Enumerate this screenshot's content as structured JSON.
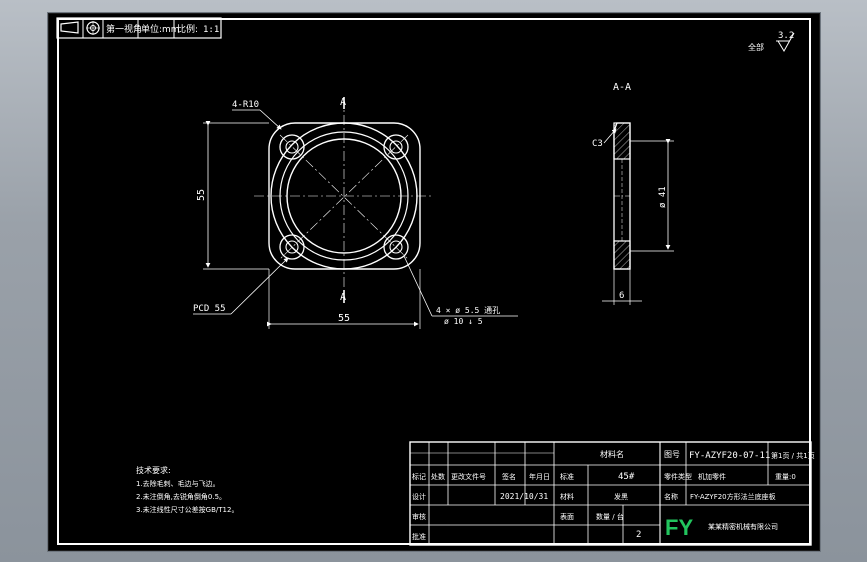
{
  "corner_tag": {
    "label1": "第一视角",
    "label2": "单位:mm",
    "label3": "比例:",
    "scale": "1:1"
  },
  "roughness": {
    "prefix": "全部",
    "value": "3.2"
  },
  "section": {
    "label": "A-A",
    "cut_top": "A",
    "cut_bottom": "A"
  },
  "front_view": {
    "corner_radius": "4-R10",
    "height_dim": "55",
    "width_dim": "55",
    "pcd": "PCD 55",
    "holes_note_1": "4 × ø 5.5 通孔",
    "holes_note_2": "ø 10 ↓ 5"
  },
  "side_view": {
    "chamfer": "C3",
    "dia_dim": "ø 41",
    "thickness_dim": "6"
  },
  "tech_req": {
    "title": "技术要求:",
    "lines": [
      "1.去除毛刺、毛边与飞边。",
      "2.未注倒角,去锐角倒角0.5。",
      "3.未注线性尺寸公差按GB/T12。"
    ]
  },
  "title_block": {
    "material_hdr": "材料名",
    "drawing_no": "FY-AZYF20-07-11",
    "sheet": "第1页 / 共1页",
    "col_marks": [
      "标记",
      "处数",
      "更改文件号",
      "签名",
      "年月日"
    ],
    "row_design": "设计",
    "date": "2021/10/31",
    "row_check": "审核",
    "row_approve": "批准",
    "standard_lbl": "标准",
    "material_lbl": "材料",
    "material_val": "45#",
    "name_lbl": "名称",
    "name_val": "FY-AZYF20方形法兰底座板",
    "part_type_lbl": "零件类型",
    "part_type_val": "机加零件",
    "weight": "重量:0",
    "finish_lbl": "表面",
    "finish_val": "发黑",
    "qty_lbl": "数量 / 台",
    "qty_val": "2",
    "logo": "FY",
    "company": "某某精密机械有限公司"
  }
}
